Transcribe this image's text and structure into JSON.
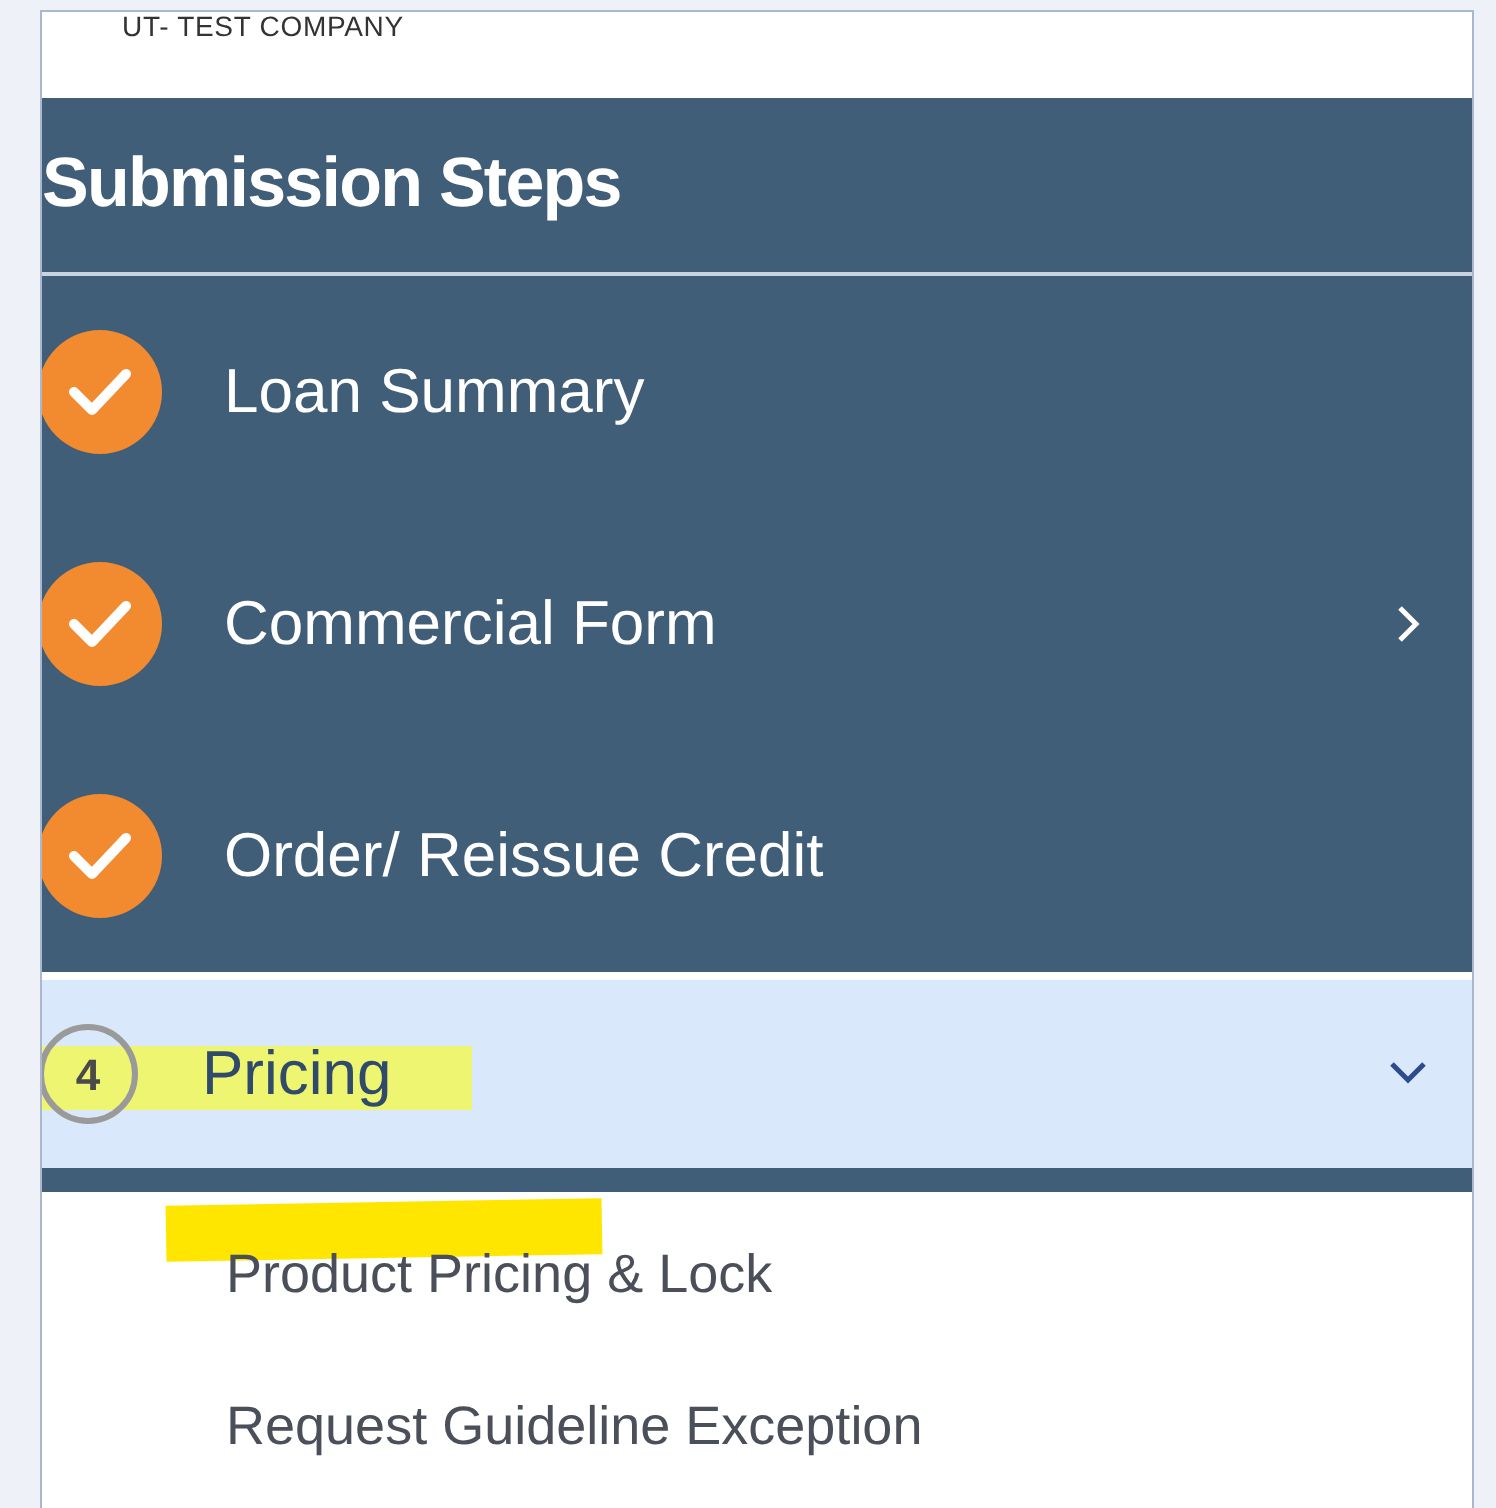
{
  "company": "UT- TEST COMPANY",
  "title": "Submission Steps",
  "steps": [
    {
      "label": "Loan Summary",
      "kind": "done",
      "selected": false
    },
    {
      "label": "Commercial Form",
      "kind": "done",
      "selected": false,
      "expanded": false
    },
    {
      "label": "Order/ Reissue Credit",
      "kind": "done",
      "selected": false
    },
    {
      "label": "Pricing",
      "kind": "current",
      "number": "4",
      "selected": true,
      "expanded": true,
      "highlighted": true,
      "children": [
        {
          "label": "Product Pricing & Lock",
          "highlighted": true
        },
        {
          "label": "Request Guideline Exception",
          "highlighted": false
        }
      ]
    }
  ]
}
